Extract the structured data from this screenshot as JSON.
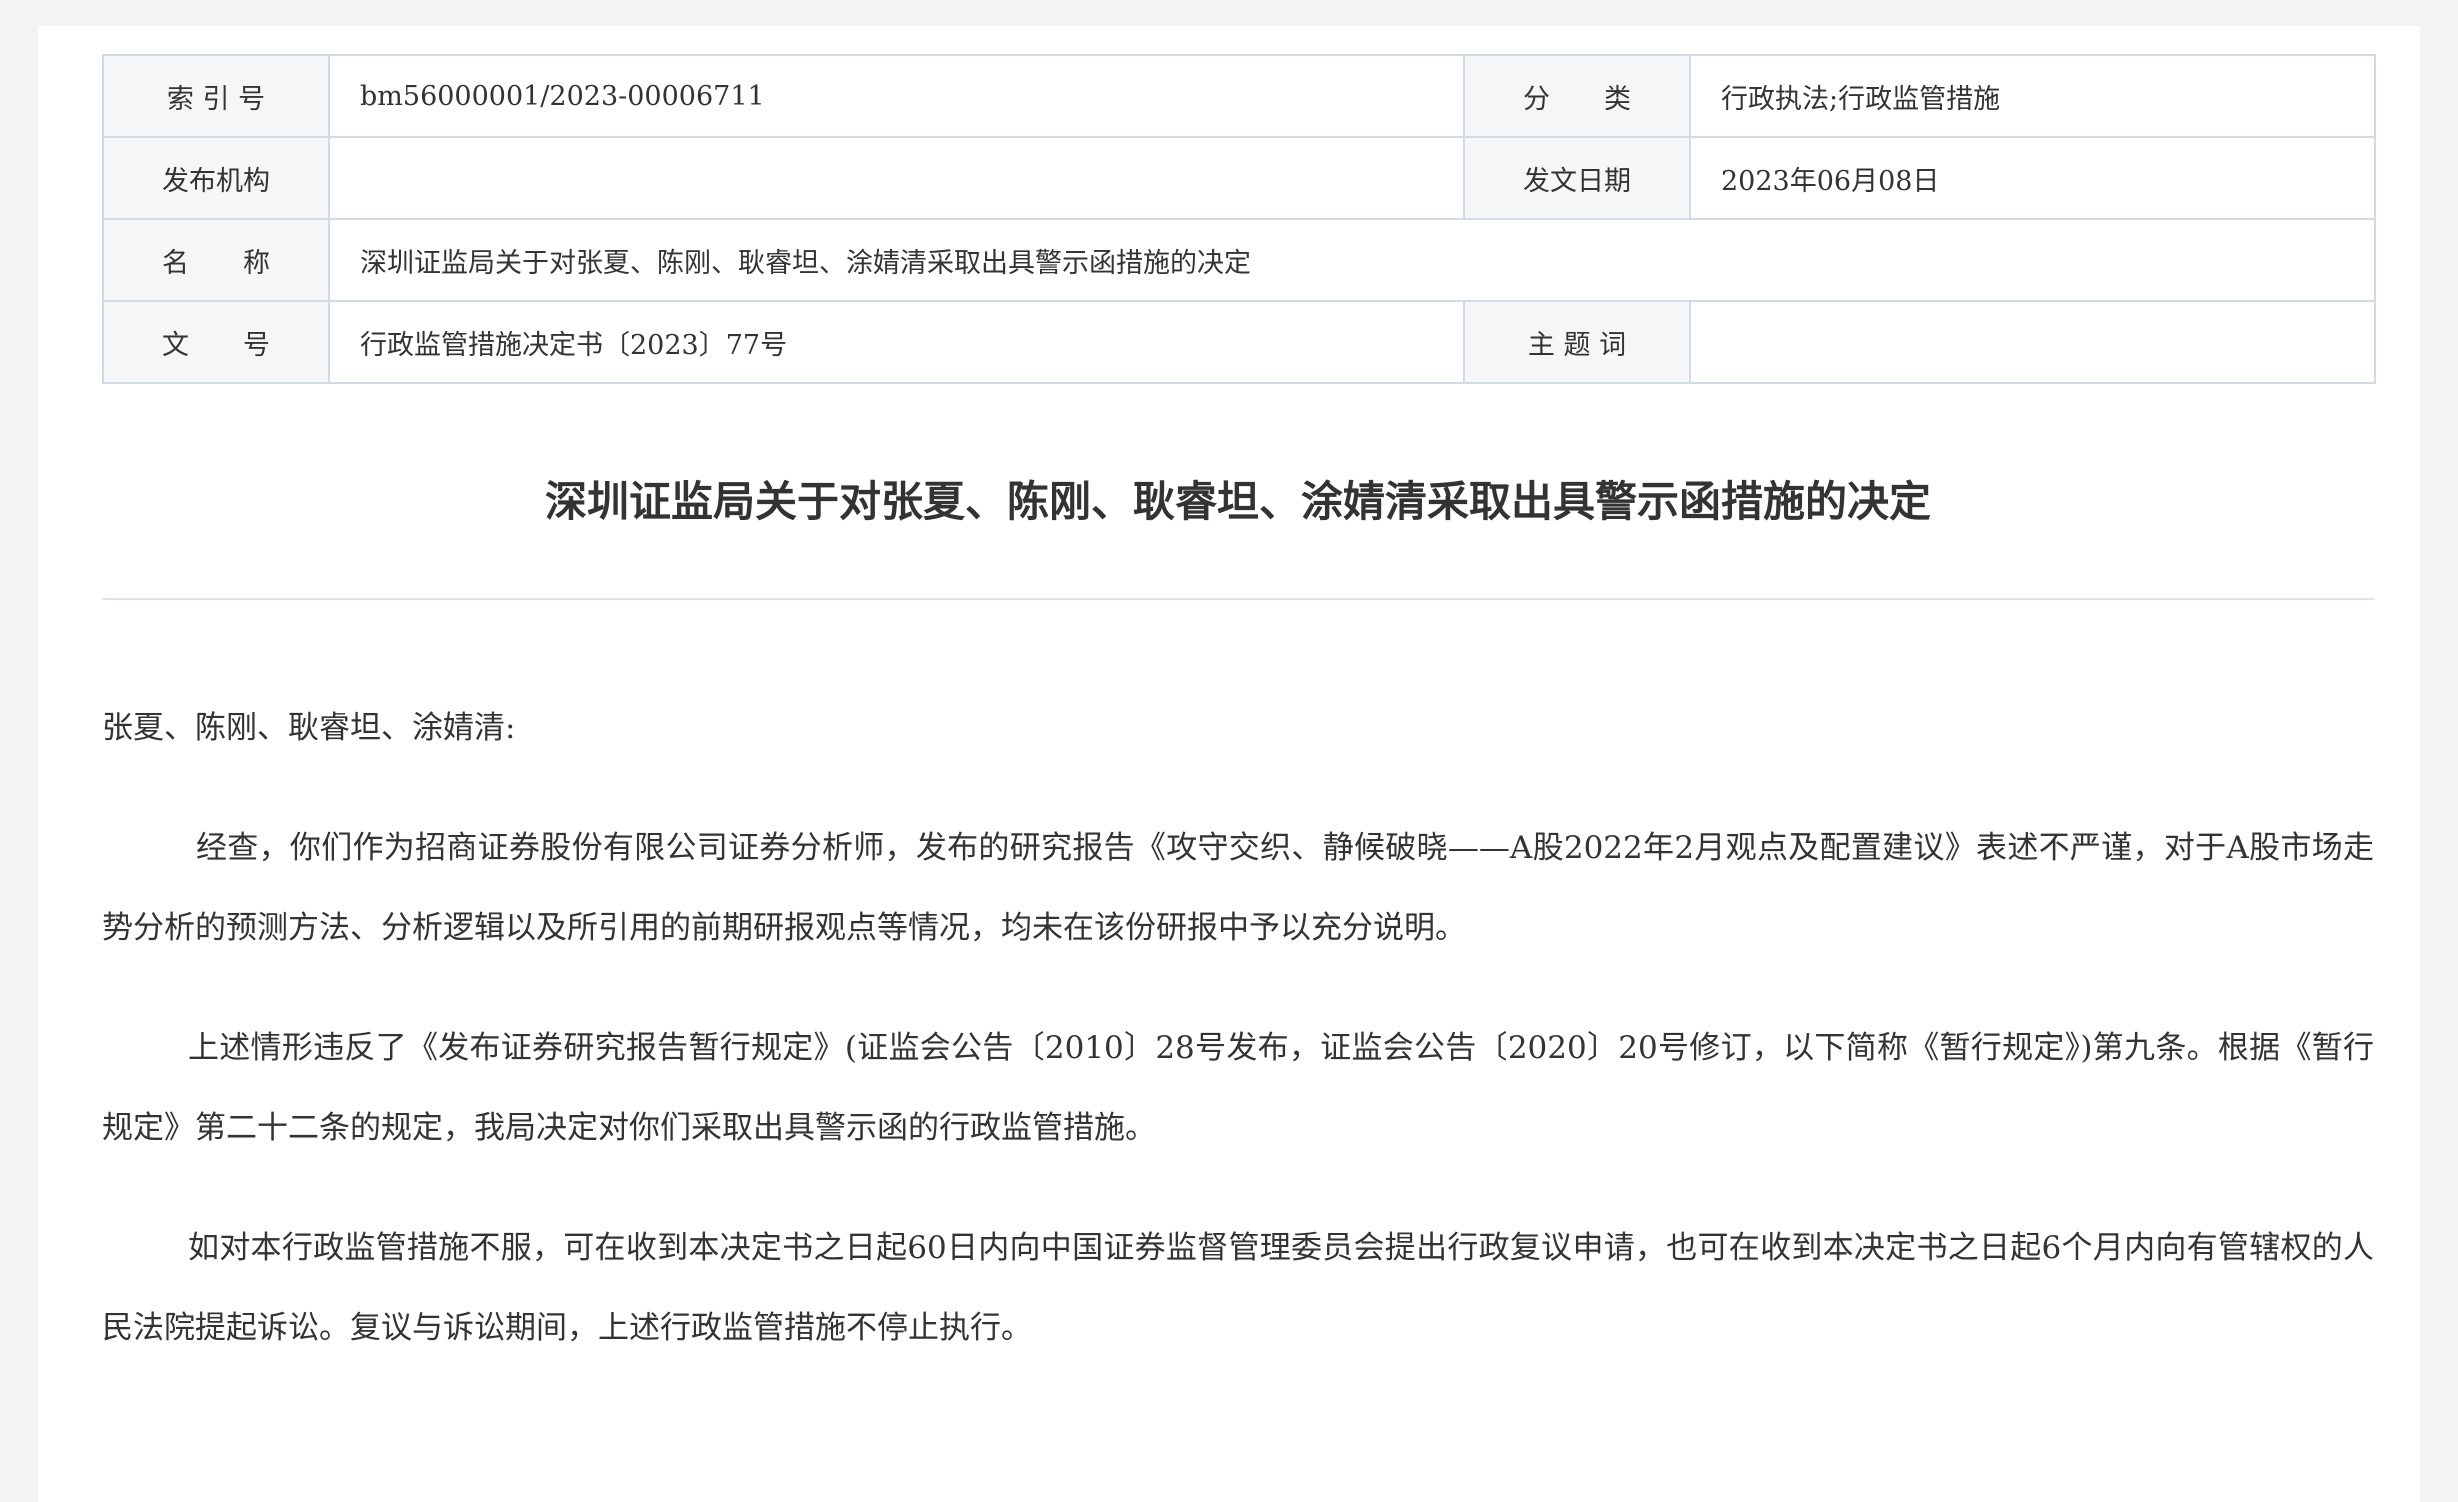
{
  "meta": {
    "index_label": "索 引 号",
    "index_value": "bm56000001/2023-00006711",
    "category_label": "分　　类",
    "category_value": "行政执法;行政监管措施",
    "publisher_label": "发布机构",
    "publisher_value": "",
    "date_label": "发文日期",
    "date_value": "2023年06月08日",
    "name_label": "名　　称",
    "name_value": "深圳证监局关于对张夏、陈刚、耿睿坦、涂婧清采取出具警示函措施的决定",
    "docno_label": "文　　号",
    "docno_value": "行政监管措施决定书〔2023〕77号",
    "keywords_label": "主 题 词",
    "keywords_value": ""
  },
  "document": {
    "title": "深圳证监局关于对张夏、陈刚、耿睿坦、涂婧清采取出具警示函措施的决定",
    "salutation": "张夏、陈刚、耿睿坦、涂婧清:",
    "paragraphs": [
      "经查，你们作为招商证券股份有限公司证券分析师，发布的研究报告《攻守交织、静候破晓——A股2022年2月观点及配置建议》表述不严谨，对于A股市场走势分析的预测方法、分析逻辑以及所引用的前期研报观点等情况，均未在该份研报中予以充分说明。",
      "上述情形违反了《发布证券研究报告暂行规定》(证监会公告〔2010〕28号发布，证监会公告〔2020〕20号修订，以下简称《暂行规定》)第九条。根据《暂行规定》第二十二条的规定，我局决定对你们采取出具警示函的行政监管措施。",
      "如对本行政监管措施不服，可在收到本决定书之日起60日内向中国证券监督管理委员会提出行政复议申请，也可在收到本决定书之日起6个月内向有管辖权的人民法院提起诉讼。复议与诉讼期间，上述行政监管措施不停止执行。"
    ]
  }
}
